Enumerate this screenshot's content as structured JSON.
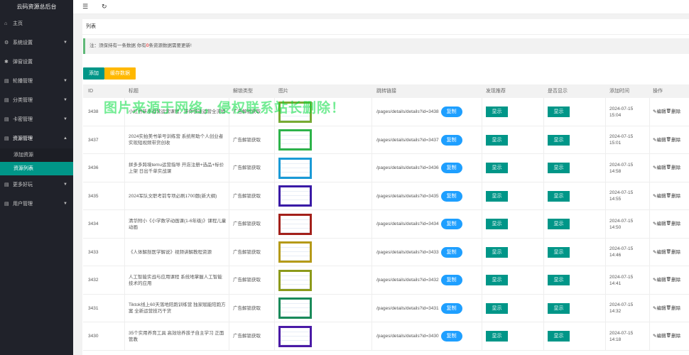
{
  "sidebar": {
    "brand": "云码资源总后台",
    "items": [
      {
        "icon": "home-icon",
        "glyph": "⌂",
        "label": "主页",
        "arrow": ""
      },
      {
        "icon": "gear-icon",
        "glyph": "⚙",
        "label": "系统设置",
        "arrow": "▼"
      },
      {
        "icon": "popup-icon",
        "glyph": "✱",
        "label": "弹窗设置",
        "arrow": ""
      },
      {
        "icon": "carousel-icon",
        "glyph": "▤",
        "label": "轮播管理",
        "arrow": "▼"
      },
      {
        "icon": "category-icon",
        "glyph": "▤",
        "label": "分类管理",
        "arrow": "▼"
      },
      {
        "icon": "card-icon",
        "glyph": "▤",
        "label": "卡密管理",
        "arrow": "▼"
      },
      {
        "icon": "resource-icon",
        "glyph": "▤",
        "label": "资源管理",
        "arrow": "▲"
      }
    ],
    "sub_items": [
      {
        "label": "添加资源"
      },
      {
        "label": "资源列表"
      }
    ],
    "bottom_items": [
      {
        "icon": "more-icon",
        "glyph": "▤",
        "label": "更多好玩",
        "arrow": "▼"
      },
      {
        "icon": "user-icon",
        "glyph": "▤",
        "label": "用户管理",
        "arrow": "▼"
      }
    ]
  },
  "topbar": {
    "menu_icon": "☰",
    "refresh_icon": "↻"
  },
  "card": {
    "title": "列表",
    "notice_prefix": "注：须保持有一条数据   你有",
    "notice_count": "0",
    "notice_suffix": "条资源数据需要更新!"
  },
  "buttons": {
    "add": "添加",
    "refresh": "缓存数据"
  },
  "table": {
    "headers": {
      "id": "ID",
      "title": "标题",
      "type": "解锁类型",
      "image": "图片",
      "link": "跳转链接",
      "recommend": "发现推荐",
      "visible": "是否显示",
      "time": "添加时间",
      "ops": "操作"
    },
    "rows": [
      {
        "id": "3438",
        "title": "小红书新手运营运营课程，带你快速运营全流程",
        "type": "广告解锁获取",
        "link": "/pages/details/details?id=3438",
        "copy": "复制",
        "recommend": "显示",
        "visible": "显示",
        "date": "2024-07-15",
        "time": "15:04",
        "edit": "编辑",
        "del": "删除",
        "frame": "#7a3"
      },
      {
        "id": "3437",
        "title": "2024实拍美书单号训练营 系统帮助个人创业者实现短视频带货创收",
        "type": "广告解锁获取",
        "link": "/pages/details/details?id=3437",
        "copy": "复制",
        "recommend": "显示",
        "visible": "显示",
        "date": "2024-07-15",
        "time": "15:01",
        "edit": "编辑",
        "del": "删除",
        "frame": "#2db34a"
      },
      {
        "id": "3436",
        "title": "拼多多跨境temu运营指导 开店注册+选品+标价上架 日出千单实战课",
        "type": "广告解锁获取",
        "link": "/pages/details/details?id=3436",
        "copy": "复制",
        "recommend": "显示",
        "visible": "显示",
        "date": "2024-07-15",
        "time": "14:58",
        "edit": "编辑",
        "del": "删除",
        "frame": "#1a9ad6"
      },
      {
        "id": "3435",
        "title": "2024军队文职考前专项必刷1700题(新大纲)",
        "type": "广告解锁获取",
        "link": "/pages/details/details?id=3435",
        "copy": "复制",
        "recommend": "显示",
        "visible": "显示",
        "date": "2024-07-15",
        "time": "14:55",
        "edit": "编辑",
        "del": "删除",
        "frame": "#3a1aa6"
      },
      {
        "id": "3434",
        "title": "清华附小《小学数学动画课(1-6年级)》课程儿童动画",
        "type": "广告解锁获取",
        "link": "/pages/details/details?id=3434",
        "copy": "复制",
        "recommend": "显示",
        "visible": "显示",
        "date": "2024-07-15",
        "time": "14:50",
        "edit": "编辑",
        "del": "删除",
        "frame": "#a3201a"
      },
      {
        "id": "3433",
        "title": "《人体解剖医学解说》视频讲解教程资源",
        "type": "广告解锁获取",
        "link": "/pages/details/details?id=3433",
        "copy": "复制",
        "recommend": "显示",
        "visible": "显示",
        "date": "2024-07-15",
        "time": "14:46",
        "edit": "编辑",
        "del": "删除",
        "frame": "#b59a18"
      },
      {
        "id": "3432",
        "title": "人工智能实战与应用课程 系统地掌握人工智能技术的应用",
        "type": "广告解锁获取",
        "link": "/pages/details/details?id=3432",
        "copy": "复制",
        "recommend": "显示",
        "visible": "显示",
        "date": "2024-07-15",
        "time": "14:41",
        "edit": "编辑",
        "del": "删除",
        "frame": "#8c9a1a"
      },
      {
        "id": "3431",
        "title": "Tiktok线上60天落地陪跑训练营 独家赋能陪跑方案 全新运营技巧干货",
        "type": "广告解锁获取",
        "link": "/pages/details/details?id=3431",
        "copy": "复制",
        "recommend": "显示",
        "visible": "显示",
        "date": "2024-07-15",
        "time": "14:32",
        "edit": "编辑",
        "del": "删除",
        "frame": "#1a8a5a"
      },
      {
        "id": "3430",
        "title": "35个实用养育工具 高效培养孩子自主学习 正面管教",
        "type": "广告解锁获取",
        "link": "/pages/details/details?id=3430",
        "copy": "复制",
        "recommend": "显示",
        "visible": "显示",
        "date": "2024-07-15",
        "time": "14:18",
        "edit": "编辑",
        "del": "删除",
        "frame": "#4a1aa6"
      }
    ]
  },
  "watermark": "图片来源于网络，侵权联系站长删除！"
}
